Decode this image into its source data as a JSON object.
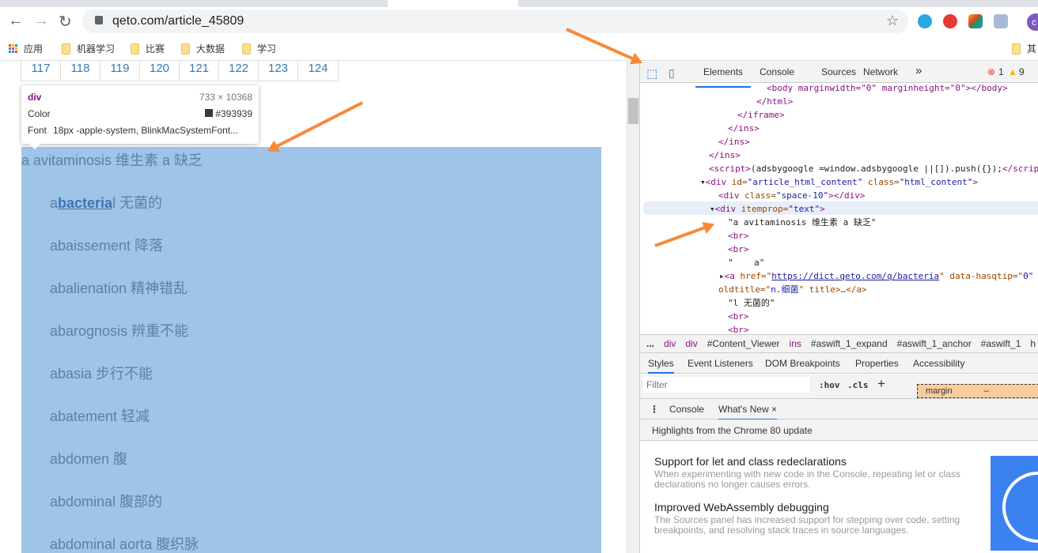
{
  "browser": {
    "url": "qeto.com/article_45809",
    "avatar_letter": "c",
    "bookmarks": [
      {
        "label": "应用",
        "icon": "apps-grid-icon"
      },
      {
        "label": "机器学习",
        "icon": "folder-icon"
      },
      {
        "label": "比赛",
        "icon": "folder-icon"
      },
      {
        "label": "大数据",
        "icon": "folder-icon"
      },
      {
        "label": "学习",
        "icon": "folder-icon"
      },
      {
        "label": "其",
        "icon": "folder-icon"
      }
    ]
  },
  "page": {
    "pager": [
      "117",
      "118",
      "119",
      "120",
      "121",
      "122",
      "123",
      "124"
    ],
    "tooltip": {
      "tag": "div",
      "size": "733 × 10368",
      "color_label": "Color",
      "color_value": "#393939",
      "font_label": "Font",
      "font_value": "18px -apple-system, BlinkMacSystemFont..."
    },
    "first_entry": "a avitaminosis 维生素 a 缺乏",
    "bacterial": {
      "pre": "a",
      "link": "bacteria",
      "post": "l 无菌的"
    },
    "entries": [
      "abaissement 降落",
      "abalienation 精神错乱",
      "abarognosis 辨重不能",
      "abasia 步行不能",
      "abatement 轻减",
      "abdomen 腹",
      "abdominal 腹部的",
      "abdominal aorta 腹织脉"
    ],
    "highlight_color": "#9fc4e8"
  },
  "devtools": {
    "tabs": [
      "Elements",
      "Console",
      "Sources",
      "Network"
    ],
    "more": "»",
    "errors": "1",
    "warnings": "9",
    "breadcrumbs": [
      "...",
      "div",
      "div",
      "#Content_Viewer",
      "ins",
      "#aswift_1_expand",
      "#aswift_1_anchor",
      "#aswift_1",
      "h"
    ],
    "sub_tabs": [
      "Styles",
      "Event Listeners",
      "DOM Breakpoints",
      "Properties",
      "Accessibility"
    ],
    "filter_placeholder": "Filter",
    "hov": ":hov",
    "cls": ".cls",
    "plus": "+",
    "box_margin": "margin",
    "box_dash": "–",
    "drawer_tabs": [
      "Console",
      "What's New"
    ],
    "close": "×",
    "highlights": "Highlights from the Chrome 80 update",
    "news": [
      {
        "title": "Support for let and class redeclarations",
        "body": "When experimenting with new code in the Console, repeating let or class declarations no longer causes errors."
      },
      {
        "title": "Improved WebAssembly debugging",
        "body": "The Sources panel has increased support for stepping over code, setting breakpoints, and resolving stack traces in source languages."
      }
    ],
    "code": {
      "l1": "<body marginwidth=\"0\" marginheight=\"0\"></body>",
      "l2": "</html>",
      "l3": "</iframe>",
      "l4": "</ins>",
      "l5": "</ins>",
      "l6": "</ins>",
      "l7a": "<script>",
      "l7b": "(adsbygoogle =window.adsbygoogle ||[]).push({});",
      "l7c": "</script>",
      "l8a": "<div ",
      "l8b": "id=",
      "l8c": "\"article_html_content\"",
      "l8d": " class=",
      "l8e": "\"html_content\"",
      "l8f": ">",
      "l9a": "<div ",
      "l9b": "class=",
      "l9c": "\"space-10\"",
      "l9d": "></div>",
      "l10a": "<div ",
      "l10b": "itemprop=",
      "l10c": "\"text\"",
      "l10d": ">",
      "l11": "\"a avitaminosis 维生素 a 缺乏\"",
      "l12": "<br>",
      "l13": "<br>",
      "l14": "\"    a\"",
      "l15a": "<a ",
      "l15b": "href=\"",
      "l15c": "https://dict.qeto.com/q/bacteria",
      "l15d": "\" data-hasqtip=\"",
      "l15e": "0\"",
      "l16a": "oldtitle=\"",
      "l16b": "n.细菌",
      "l16c": "\" title>…</a>",
      "l17": "\"l 无菌的\"",
      "l18": "<br>",
      "l19": "<br>"
    }
  }
}
